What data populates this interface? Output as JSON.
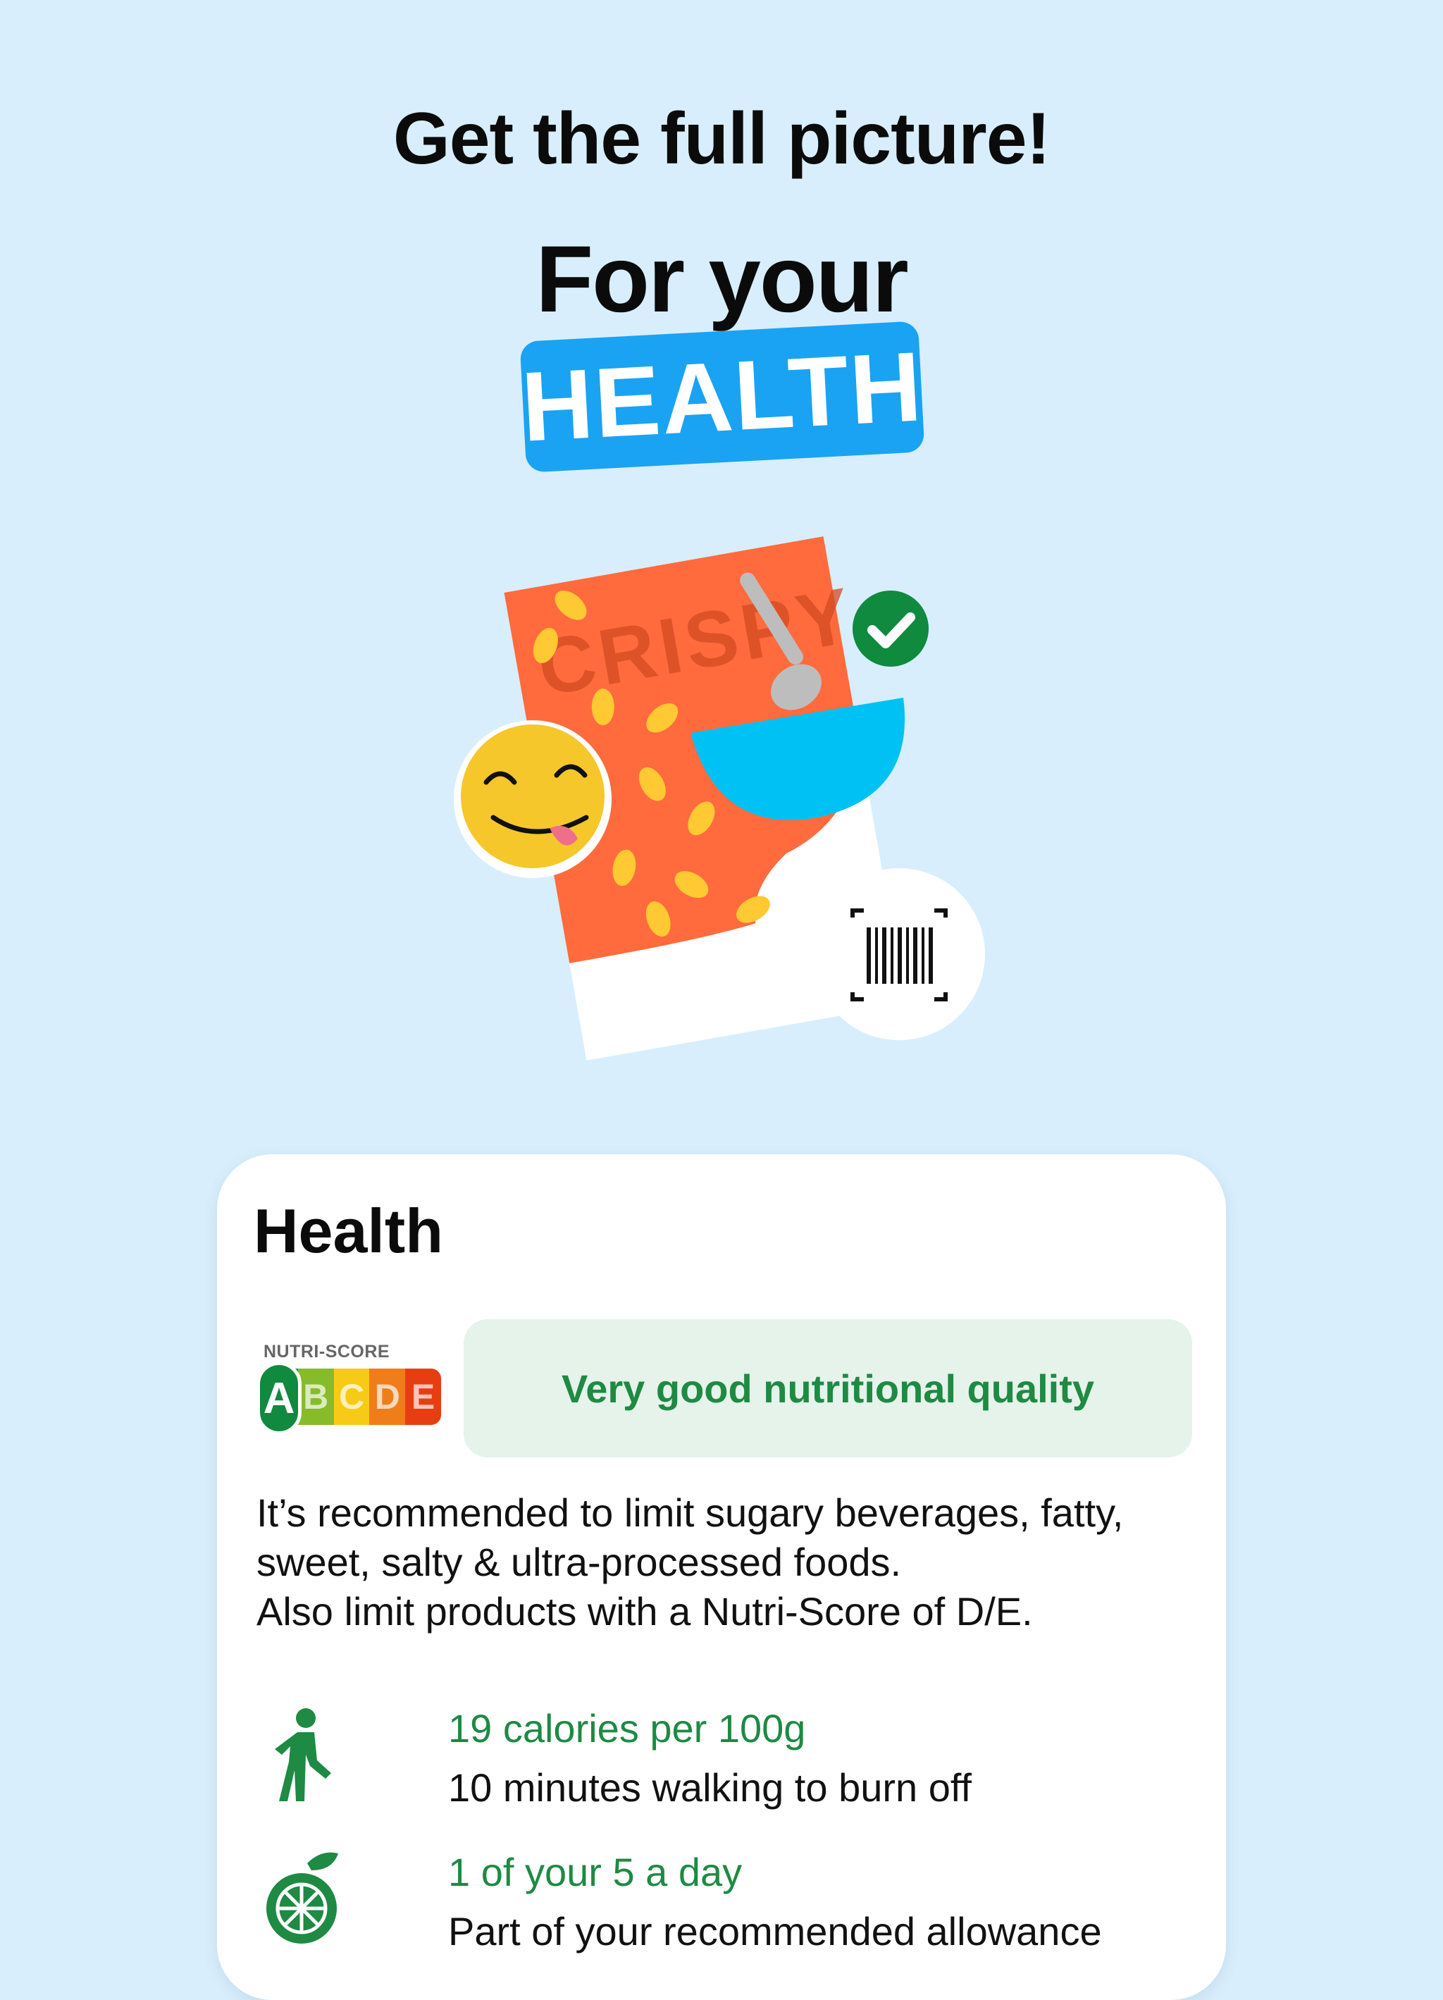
{
  "hero": {
    "headline": "Get the full picture!",
    "subhead": "For your",
    "tag": "HEALTH"
  },
  "illustration": {
    "package_text": "CRISPY",
    "icons": [
      "crispy-package-icon",
      "spoon-icon",
      "bowl-icon",
      "yum-face-icon",
      "checkmark-badge-icon",
      "barcode-scan-icon"
    ]
  },
  "card": {
    "title": "Health",
    "nutri_score": {
      "label": "NUTRI-SCORE",
      "grades": [
        "A",
        "B",
        "C",
        "D",
        "E"
      ],
      "selected": "A",
      "colors": [
        "#0f8a3e",
        "#86bc2a",
        "#f7cb15",
        "#ef7d1a",
        "#e63e11"
      ]
    },
    "quality_text": "Very good nutritional quality",
    "advice_lines": [
      "It’s recommended to limit sugary beverages, fatty,",
      "sweet, salty & ultra-processed foods.",
      "Also limit products with a Nutri-Score of D/E."
    ],
    "stats": [
      {
        "icon": "walking-person-icon",
        "primary": "19 calories per 100g",
        "secondary": "10 minutes walking to burn off"
      },
      {
        "icon": "citrus-fruit-icon",
        "primary": "1 of your 5 a day",
        "secondary": "Part of your recommended allowance"
      }
    ]
  },
  "colors": {
    "background": "#d8eefc",
    "accent_blue": "#1aa3f2",
    "green": "#1e8a43",
    "quality_bg": "#e5f3ea"
  }
}
